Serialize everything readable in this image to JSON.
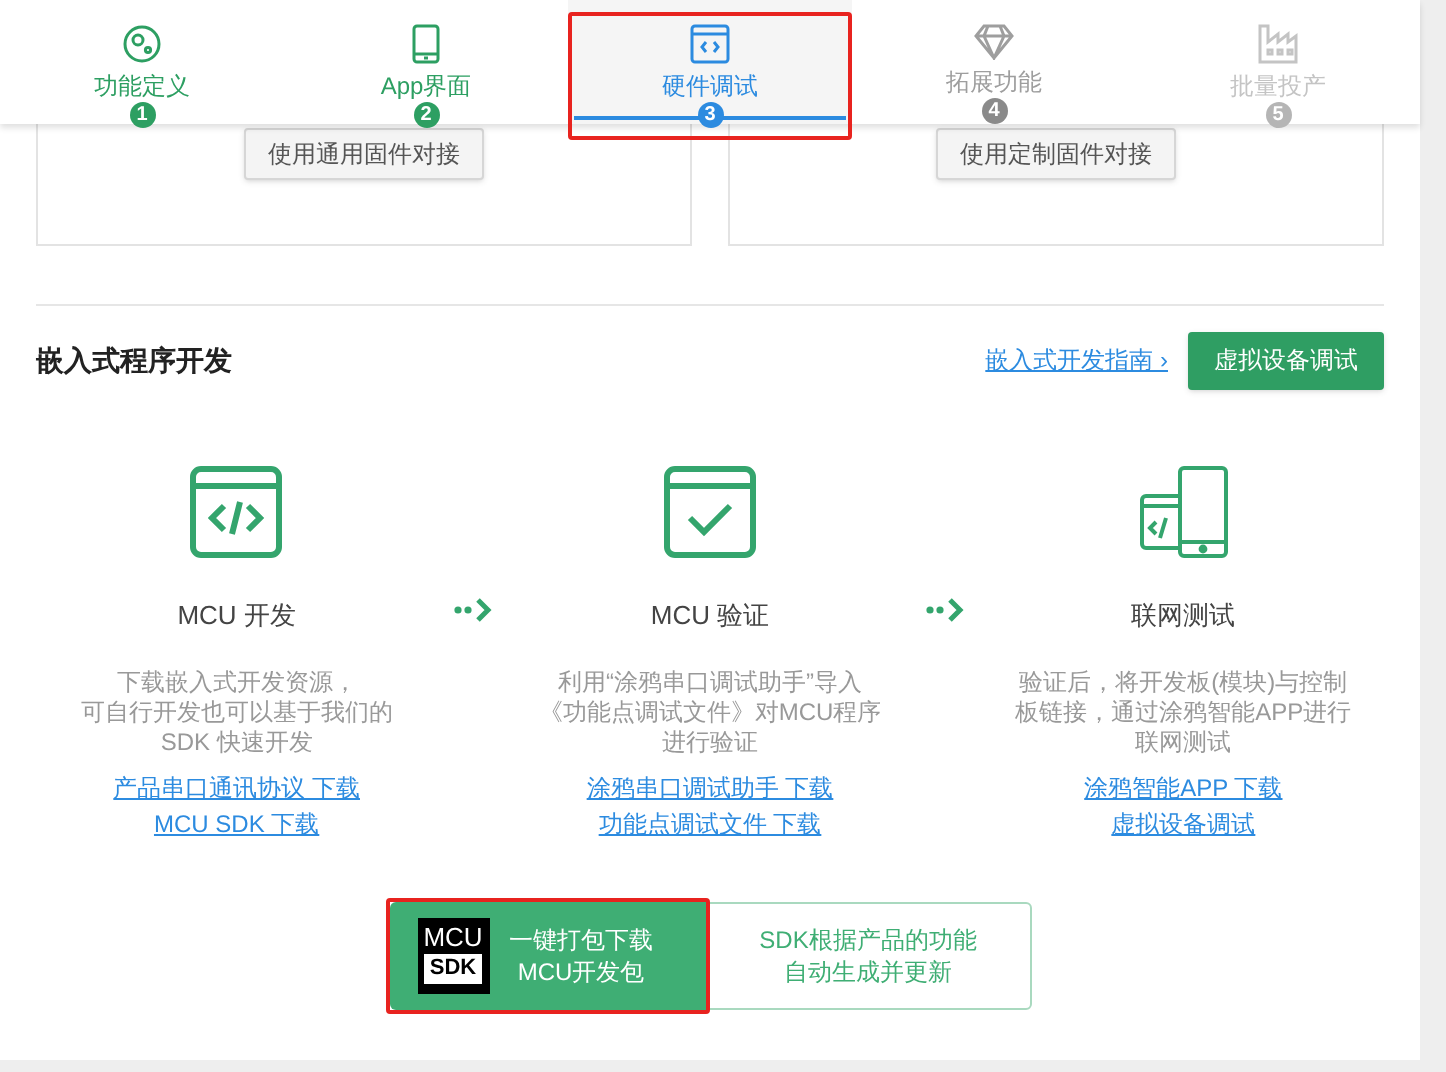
{
  "steps": [
    {
      "label": "功能定义",
      "number": "1",
      "kind": "done",
      "highlighted": false
    },
    {
      "label": "App界面",
      "number": "2",
      "kind": "done",
      "highlighted": false
    },
    {
      "label": "硬件调试",
      "number": "3",
      "kind": "current",
      "highlighted": true
    },
    {
      "label": "拓展功能",
      "number": "4",
      "kind": "todo",
      "highlighted": false
    },
    {
      "label": "批量投产",
      "number": "5",
      "kind": "disabled",
      "highlighted": false
    }
  ],
  "firmware_buttons": [
    "使用通用固件对接",
    "使用定制固件对接"
  ],
  "section": {
    "title": "嵌入式程序开发",
    "guide_link": "嵌入式开发指南",
    "guide_chevron": "›",
    "button": "虚拟设备调试"
  },
  "stages": [
    {
      "title": "MCU 开发",
      "description_lines": [
        "下载嵌入式开发资源，",
        "可自行开发也可以基于我们的",
        "SDK 快速开发"
      ],
      "links": [
        "产品串口通讯协议 下载",
        "MCU SDK 下载"
      ]
    },
    {
      "title": "MCU 验证",
      "description_lines": [
        "利用“涂鸦串口调试助手”导入",
        "《功能点调试文件》对MCU程序",
        "进行验证"
      ],
      "links": [
        "涂鸦串口调试助手 下载",
        "功能点调试文件 下载"
      ]
    },
    {
      "title": "联网测试",
      "description_lines": [
        "验证后，将开发板(模块)与控制",
        "板链接，通过涂鸦智能APP进行",
        "联网测试"
      ],
      "links": [
        "涂鸦智能APP 下载",
        "虚拟设备调试"
      ]
    }
  ],
  "package": {
    "logo_top": "MCU",
    "logo_bottom": "SDK",
    "button": "一键打包下载\nMCU开发包",
    "note_lines": [
      "SDK根据产品的功能",
      "自动生成并更新"
    ],
    "highlighted": true
  }
}
